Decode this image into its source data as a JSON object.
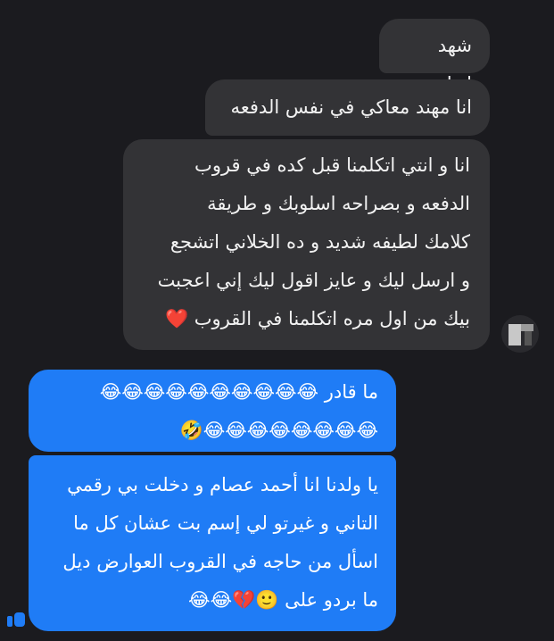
{
  "colors": {
    "background": "#1b1b1f",
    "incoming_bubble": "#333336",
    "outgoing_bubble": "#1f7cf6"
  },
  "incoming_messages": [
    {
      "text": "شهد إزيك"
    },
    {
      "text": "انا مهند معاكي في نفس الدفعه"
    },
    {
      "text": "انا و انتي اتكلمنا قبل كده في قروب\nالدفعه و بصراحه اسلوبك و طريقة\nكلامك لطيفه شديد و ده الخلاني اتشجع\nو ارسل ليك و عايز اقول ليك إني اعجبت\nبيك من اول مره اتكلمنا في القروب ❤️"
    }
  ],
  "outgoing_messages": [
    {
      "text": "ما قادر 😂😂😂😂😂😂😂😂😂😂\n😂😂😂😂😂😂😂😂🤣"
    },
    {
      "text": "يا ولدنا انا أحمد عصام و دخلت بي رقمي\nالتاني و غيرتو لي إسم بت عشان كل ما\nاسأل من حاجه في القروب العوارض ديل\nما بردو على 🙂💔😂😂"
    }
  ],
  "icons": {
    "avatar": "sender-avatar",
    "receipt": "read-receipt-icon"
  }
}
